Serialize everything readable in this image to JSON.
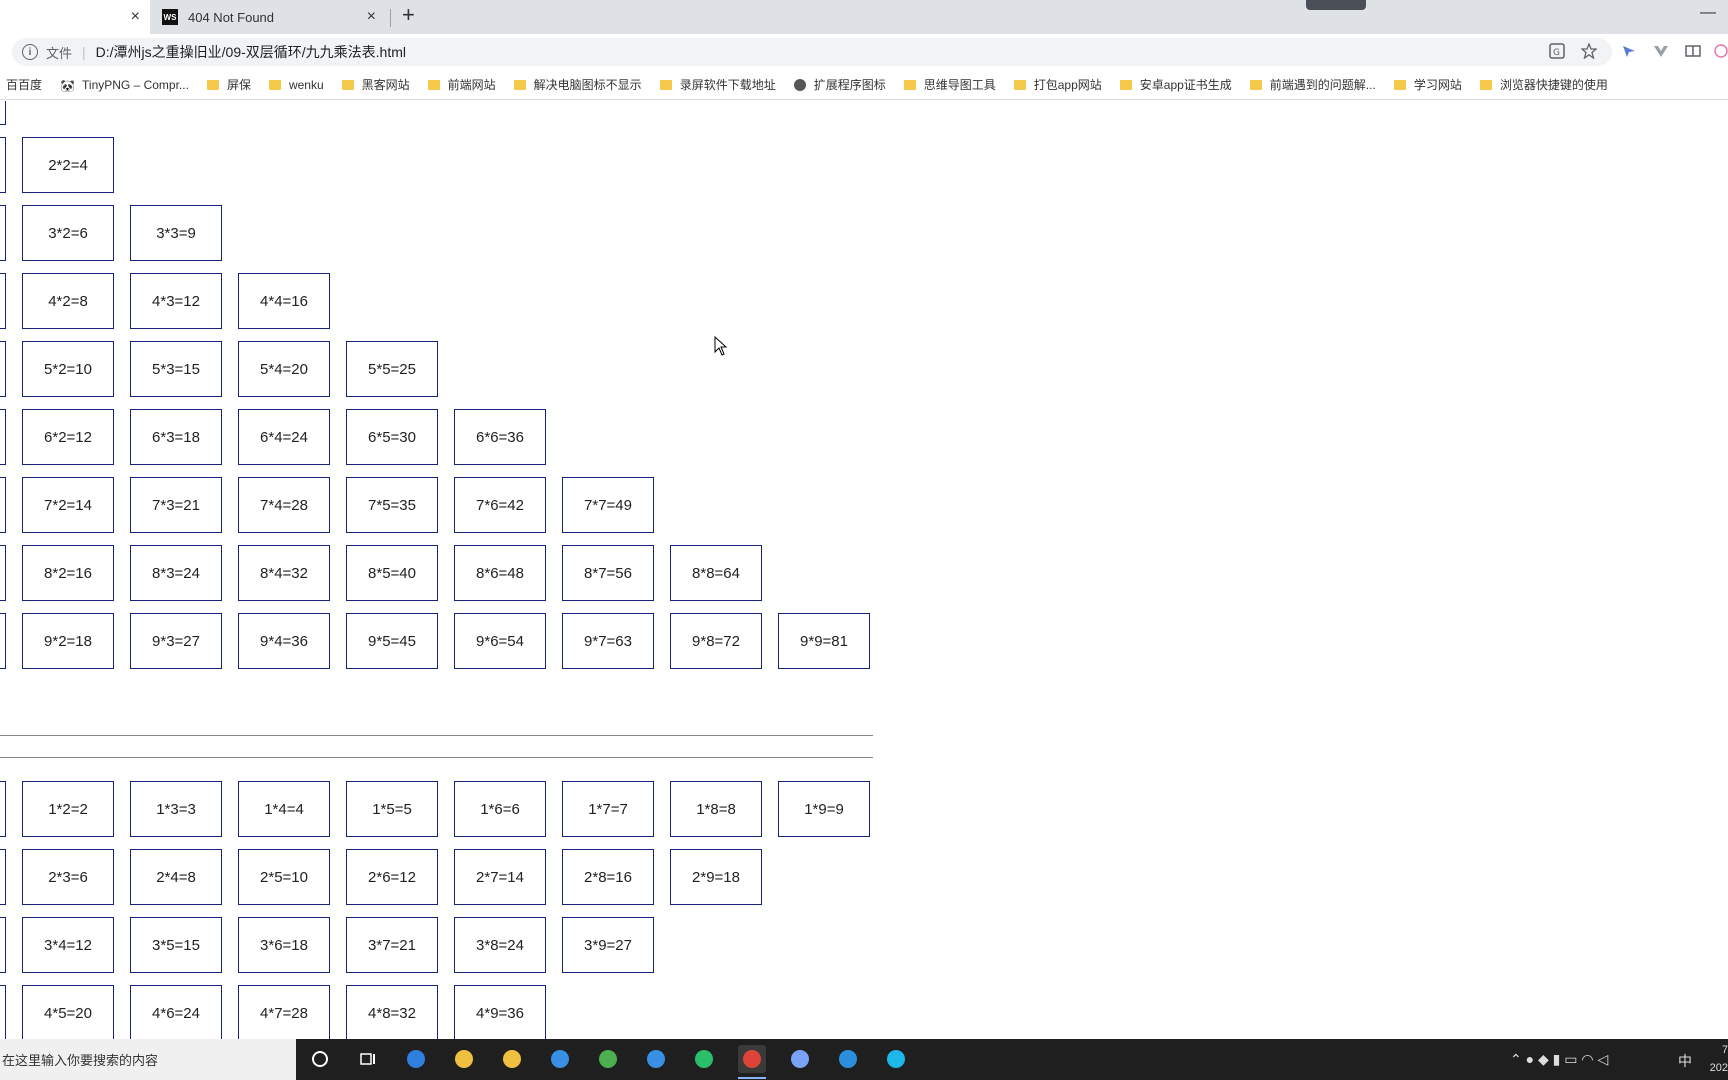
{
  "tabs": {
    "active": {
      "title": "",
      "close": "×"
    },
    "inactive": {
      "favicon": "WS",
      "title": "404 Not Found",
      "close": "×"
    },
    "new_tab": "+",
    "minimize": "—"
  },
  "omnibox": {
    "info_icon": "i",
    "scheme_label": "文件",
    "separator": "|",
    "url": "D:/潭州js之重操旧业/09-双层循环/九九乘法表.html"
  },
  "toolbar_icons": [
    "translate-icon",
    "star-icon",
    "extension-icon",
    "vue-devtools-icon",
    "reader-icon",
    "profile-icon"
  ],
  "bookmarks": [
    {
      "type": "none",
      "label": "百百度"
    },
    {
      "type": "panda",
      "label": "TinyPNG – Compr..."
    },
    {
      "type": "folder",
      "label": "屏保"
    },
    {
      "type": "folder",
      "label": "wenku"
    },
    {
      "type": "folder",
      "label": "黑客网站"
    },
    {
      "type": "folder",
      "label": "前端网站"
    },
    {
      "type": "folder",
      "label": "解决电脑图标不显示"
    },
    {
      "type": "folder",
      "label": "录屏软件下载地址"
    },
    {
      "type": "globe",
      "label": "扩展程序图标"
    },
    {
      "type": "folder",
      "label": "思维导图工具"
    },
    {
      "type": "folder",
      "label": "打包app网站"
    },
    {
      "type": "folder",
      "label": "安卓app证书生成"
    },
    {
      "type": "folder",
      "label": "前端遇到的问题解..."
    },
    {
      "type": "folder",
      "label": "学习网站"
    },
    {
      "type": "folder",
      "label": "浏览器快捷键的使用"
    }
  ],
  "table1_rows": [
    [
      ""
    ],
    [
      "",
      "2*2=4"
    ],
    [
      "",
      "3*2=6",
      "3*3=9"
    ],
    [
      "",
      "4*2=8",
      "4*3=12",
      "4*4=16"
    ],
    [
      "",
      "5*2=10",
      "5*3=15",
      "5*4=20",
      "5*5=25"
    ],
    [
      "",
      "6*2=12",
      "6*3=18",
      "6*4=24",
      "6*5=30",
      "6*6=36"
    ],
    [
      "",
      "7*2=14",
      "7*3=21",
      "7*4=28",
      "7*5=35",
      "7*6=42",
      "7*7=49"
    ],
    [
      "",
      "8*2=16",
      "8*3=24",
      "8*4=32",
      "8*5=40",
      "8*6=48",
      "8*7=56",
      "8*8=64"
    ],
    [
      "",
      "9*2=18",
      "9*3=27",
      "9*4=36",
      "9*5=45",
      "9*6=54",
      "9*7=63",
      "9*8=72",
      "9*9=81"
    ]
  ],
  "table2_rows": [
    [
      "",
      "1*2=2",
      "1*3=3",
      "1*4=4",
      "1*5=5",
      "1*6=6",
      "1*7=7",
      "1*8=8",
      "1*9=9"
    ],
    [
      "",
      "2*3=6",
      "2*4=8",
      "2*5=10",
      "2*6=12",
      "2*7=14",
      "2*8=16",
      "2*9=18"
    ],
    [
      "",
      "3*4=12",
      "3*5=15",
      "3*6=18",
      "3*7=21",
      "3*8=24",
      "3*9=27"
    ],
    [
      "",
      "4*5=20",
      "4*6=24",
      "4*7=28",
      "4*8=32",
      "4*9=36"
    ]
  ],
  "taskbar": {
    "search_placeholder": "在这里输入你要搜索的内容",
    "apps": [
      "cortana-icon",
      "task-view-icon",
      "edge-icon",
      "file-explorer-icon",
      "store-icon",
      "mail-icon",
      "green-browser-icon",
      "ie-icon",
      "edge-beta-icon",
      "chrome-icon",
      "feishu-icon",
      "vscode-icon",
      "webstorm-icon"
    ],
    "ime": "中",
    "clock_time": "7",
    "clock_date": "202"
  }
}
